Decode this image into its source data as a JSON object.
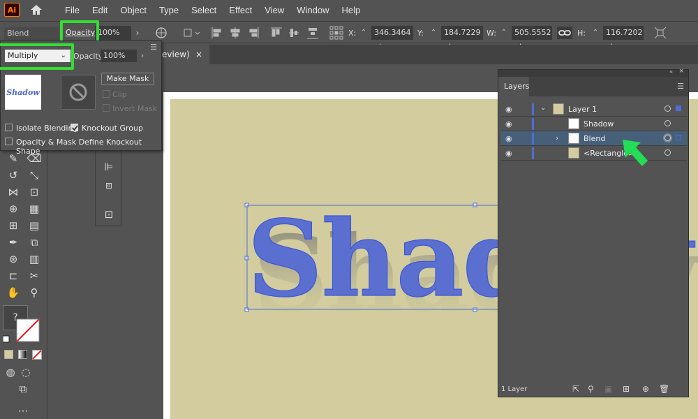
{
  "app": {
    "logo": "Ai"
  },
  "menu": [
    "File",
    "Edit",
    "Object",
    "Type",
    "Select",
    "Effect",
    "View",
    "Window",
    "Help"
  ],
  "control_bar": {
    "blend_label": "Blend",
    "opacity_label": "Opacity:",
    "opacity_value": "100%",
    "x_label": "X:",
    "x_value": "346.3464 pt",
    "y_label": "Y:",
    "y_value": "184.7229 pt",
    "w_label": "W:",
    "w_value": "505.5552 pt",
    "h_label": "H:",
    "h_value": "116.7202 pt"
  },
  "document_tab": {
    "title": "eview)",
    "close": "×"
  },
  "transparency_panel": {
    "blend_mode": "Multiply",
    "opacity_label": "Opacity:",
    "opacity_value": "100%",
    "thumbnail_text": "Shadow",
    "make_mask_label": "Make Mask",
    "clip_label": "Clip",
    "invert_mask_label": "Invert Mask",
    "isolate_blending_label": "Isolate Blending",
    "isolate_blending_checked": false,
    "knockout_group_label": "Knockout Group",
    "knockout_group_checked": true,
    "opacity_mask_label": "Opacity & Mask Define Knockout Shape",
    "opacity_mask_checked": false
  },
  "canvas": {
    "text": "Shadow",
    "artboard_color": "#d2cc9e",
    "text_color": "#5a6fcf"
  },
  "layers_panel": {
    "tab_label": "Layers",
    "rows": [
      {
        "name": "Layer 1"
      },
      {
        "name": "Shadow"
      },
      {
        "name": "Blend"
      },
      {
        "name": "<Rectangle>"
      }
    ],
    "footer": "1 Layer"
  },
  "accent": {
    "highlight": "#33dd33",
    "arrow": "#22dd55",
    "selection": "#4f6dd8"
  }
}
